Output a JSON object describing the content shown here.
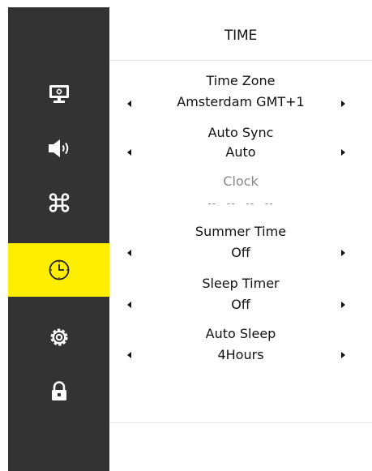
{
  "page": {
    "title": "TIME"
  },
  "sidebar": {
    "items": [
      {
        "icon": "monitor-icon",
        "active": false
      },
      {
        "icon": "speaker-icon",
        "active": false
      },
      {
        "icon": "command-icon",
        "active": false
      },
      {
        "icon": "clock-icon",
        "active": true
      },
      {
        "icon": "gear-icon",
        "active": false
      },
      {
        "icon": "lock-icon",
        "active": false
      }
    ],
    "active_color": "#ffee00",
    "background_color": "#333333"
  },
  "settings": {
    "time_zone": {
      "label": "Time Zone",
      "value": "Amsterdam GMT+1"
    },
    "auto_sync": {
      "label": "Auto Sync",
      "value": "Auto"
    },
    "clock": {
      "label": "Clock",
      "value": "-- --  -- --"
    },
    "summer_time": {
      "label": "Summer Time",
      "value": "Off"
    },
    "sleep_timer": {
      "label": "Sleep Timer",
      "value": "Off"
    },
    "auto_sleep": {
      "label": "Auto Sleep",
      "value": "4Hours"
    }
  }
}
